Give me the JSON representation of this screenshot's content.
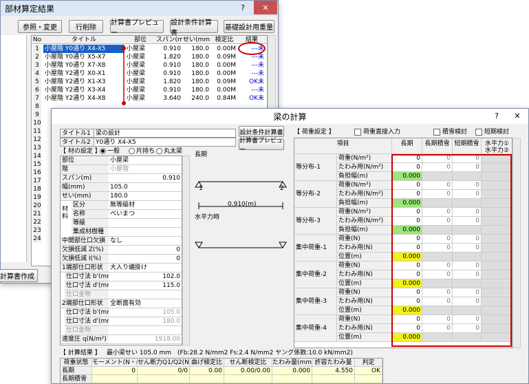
{
  "parent": {
    "title": "部材算定結果",
    "help": "?",
    "close": "✕",
    "buttons": [
      "参照・変更",
      "行削除",
      "計算書プレビュー",
      "設計条件計算書",
      "基礎設計用重量"
    ],
    "headers": [
      "No",
      "タイトル",
      "部位",
      "スパン(m)",
      "せい(mm)",
      "検定比",
      "結果"
    ],
    "rows": [
      [
        "1",
        "小屋階 Y0通り X4-X5",
        "小屋梁",
        "0.910",
        "180.0",
        "0.00M",
        "---未"
      ],
      [
        "2",
        "小屋階 Y0通り X5-X7",
        "小屋梁",
        "1.820",
        "180.0",
        "0.09M",
        "---未"
      ],
      [
        "3",
        "小屋階 Y0通り X7-X8",
        "小屋梁",
        "0.910",
        "180.0",
        "0.00M",
        "---未"
      ],
      [
        "4",
        "小屋階 Y2通り X0-X1",
        "小屋梁",
        "0.910",
        "180.0",
        "0.00M",
        "---未"
      ],
      [
        "5",
        "小屋階 Y2通り X1-X3",
        "小屋梁",
        "1.820",
        "180.0",
        "0.09M",
        "OK未"
      ],
      [
        "6",
        "小屋階 Y2通り X3-X4",
        "小屋梁",
        "0.910",
        "180.0",
        "0.00M",
        "---未"
      ],
      [
        "7",
        "小屋階 Y2通り X4-X8",
        "小屋梁",
        "3.640",
        "240.0",
        "0.84M",
        "OK未"
      ]
    ],
    "rownums": [
      "8",
      "9",
      "10",
      "11",
      "12",
      "13",
      "14",
      "15",
      "16",
      "17",
      "18",
      "19",
      "20",
      "21",
      "22",
      "23",
      "24"
    ],
    "create_button": "計算書作成"
  },
  "dlg": {
    "title": "梁の計算",
    "help": "?",
    "close": "✕",
    "title1_label": "タイトル1",
    "title1": "梁の設計",
    "title2_label": "タイトル2",
    "title2": "Y0通り X4-X5",
    "btn_cond": "設計条件計算書",
    "btn_preview": "計算書プレビュー",
    "material_label": "【 材の設定 】",
    "radio": [
      "一般",
      "片持ち",
      "丸太梁"
    ],
    "props": [
      [
        "部位",
        "小屋梁",
        ""
      ],
      [
        "階",
        "小屋階",
        ""
      ],
      [
        "スパン(m)",
        "",
        "0.910"
      ],
      [
        "幅(mm)",
        "105.0",
        ""
      ],
      [
        "せい(mm)",
        "180.0",
        ""
      ],
      [
        "区分",
        "無等級材",
        ""
      ],
      [
        "名称",
        "べいまつ",
        ""
      ],
      [
        "等級",
        "",
        ""
      ],
      [
        "集成材樹種",
        "",
        ""
      ],
      [
        "中間部仕口欠損",
        "なし",
        ""
      ],
      [
        "欠損低減 Z(%)",
        "",
        "0"
      ],
      [
        "欠損低減 I(%)",
        "",
        "0"
      ],
      [
        "1端部仕口形状",
        "大入り蟻掛け",
        ""
      ],
      [
        "仕口寸法 b'(mm)",
        "",
        "102.0"
      ],
      [
        "仕口寸法 d'(mm)",
        "",
        "115.0"
      ],
      [
        "仕口金物",
        "",
        ""
      ],
      [
        "2端部仕口形状",
        "全断面有効",
        ""
      ],
      [
        "仕口寸法 b'(mm)",
        "",
        "105.0"
      ],
      [
        "仕口寸法 d'(mm)",
        "",
        "180.0"
      ],
      [
        "仕口金物",
        "",
        ""
      ],
      [
        "速度圧 q(N/m²)",
        "",
        "1918.00"
      ]
    ],
    "zai": "材料",
    "diagram": {
      "long": "長期",
      "horiz": "水平力時",
      "span": "0.910(m)",
      "n1": "1",
      "n2": "2"
    },
    "load_label": "【 荷重設定 】",
    "check_direct": "荷重直接入力",
    "check_snow": "積雪検討",
    "check_short": "短期検討",
    "load_headers": [
      "項目",
      "長期",
      "長期積雪",
      "短期積雪",
      "水平力①\n水平力②"
    ],
    "groups": [
      {
        "name": "等分布-1",
        "rows": [
          [
            "荷重(N/m²)",
            "0",
            "0",
            "0"
          ],
          [
            "たわみ用(N/m²)",
            "0",
            "0",
            "0"
          ],
          [
            "負担幅(m)",
            "0.000",
            "",
            ""
          ]
        ]
      },
      {
        "name": "等分布-2",
        "rows": [
          [
            "荷重(N/m²)",
            "0",
            "0",
            "0"
          ],
          [
            "たわみ用(N/m²)",
            "0",
            "0",
            "0"
          ],
          [
            "負担幅(m)",
            "0.000",
            "",
            ""
          ]
        ]
      },
      {
        "name": "等分布-3",
        "rows": [
          [
            "荷重(N/m²)",
            "0",
            "0",
            "0"
          ],
          [
            "たわみ用(N/m²)",
            "0",
            "0",
            "0"
          ],
          [
            "負担幅(m)",
            "0.000",
            "",
            ""
          ]
        ]
      },
      {
        "name": "集中荷重-1",
        "rows": [
          [
            "荷重(N)",
            "0",
            "0",
            "0"
          ],
          [
            "たわみ用(N)",
            "0",
            "0",
            "0"
          ],
          [
            "位置(m)",
            "0.000",
            "",
            ""
          ]
        ]
      },
      {
        "name": "集中荷重-2",
        "rows": [
          [
            "荷重(N)",
            "0",
            "0",
            "0"
          ],
          [
            "たわみ用(N)",
            "0",
            "0",
            "0"
          ],
          [
            "位置(m)",
            "0.000",
            "",
            ""
          ]
        ]
      },
      {
        "name": "集中荷重-3",
        "rows": [
          [
            "荷重(N)",
            "0",
            "0",
            "0"
          ],
          [
            "たわみ用(N)",
            "0",
            "0",
            "0"
          ],
          [
            "位置(m)",
            "0.000",
            "",
            ""
          ]
        ]
      },
      {
        "name": "集中荷重-4",
        "rows": [
          [
            "荷重(N)",
            "0",
            "0",
            "0"
          ],
          [
            "たわみ用(N)",
            "0",
            "0",
            "0"
          ],
          [
            "位置(m)",
            "0.000",
            "",
            ""
          ]
        ]
      }
    ],
    "result_label": "【 計算結果 】",
    "result_info": "最小梁せい 105.0 mm　(Fb:28.2 N/mm2 Fs:2.4 N/mm2 ヤング係数:10.0 kN/mm2)",
    "result_headers": [
      "荷重状態",
      "モーメント(N・m)",
      "せん断力Q1/Q2(N)",
      "曲げ検定比",
      "せん断検定比",
      "たわみ量(mm)",
      "許容たわみ量",
      "判定"
    ],
    "result_rows": [
      [
        "長期",
        "0",
        "0/0",
        "0.00",
        "0.00/0.00",
        "0.000",
        "4.550",
        "OK"
      ],
      [
        "長期積雪",
        "",
        "",
        "",
        "",
        "",
        "",
        ""
      ]
    ]
  }
}
